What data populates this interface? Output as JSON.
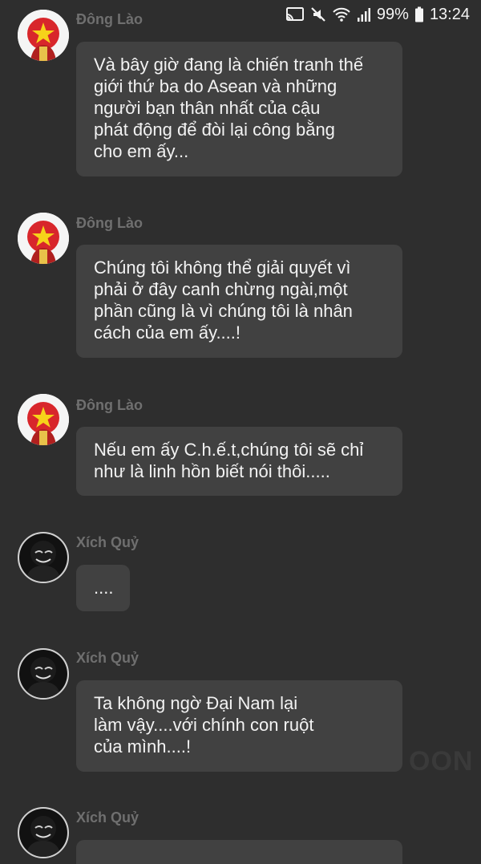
{
  "status_bar": {
    "battery": "99%",
    "time": "13:24",
    "icons": [
      "cast-icon",
      "mute-icon",
      "wifi-icon",
      "signal-icon",
      "battery-icon"
    ]
  },
  "messages": [
    {
      "sender": "Đông Lào",
      "avatar": "vietnam-flag-avatar",
      "text": "Và bây giờ đang là chiến tranh thế\ngiới thứ ba do Asean và những\nngười bạn thân nhất của cậu\nphát động để đòi lại công bằng\ncho em  ấy..."
    },
    {
      "sender": "Đông Lào",
      "avatar": "vietnam-flag-avatar",
      "text": "Chúng tôi không thể giải quyết vì\nphải ở đây canh chừng ngài,một\nphần cũng là vì chúng tôi là nhân\ncách của em ấy....!"
    },
    {
      "sender": "Đông Lào",
      "avatar": "vietnam-flag-avatar",
      "text": "Nếu em ấy C.h.ế.t,chúng tôi sẽ chỉ\nnhư là linh hồn biết nói thôi....."
    },
    {
      "sender": "Xích Quỷ",
      "avatar": "dark-character-avatar",
      "text": "...."
    },
    {
      "sender": "Xích Quỷ",
      "avatar": "dark-character-avatar",
      "text": "Ta không ngờ Đại Nam lại\nlàm vậy....với chính con ruột\ncủa mình....!"
    },
    {
      "sender": "Xích Quỷ",
      "avatar": "dark-character-avatar",
      "text": ""
    }
  ],
  "watermark": "OON"
}
